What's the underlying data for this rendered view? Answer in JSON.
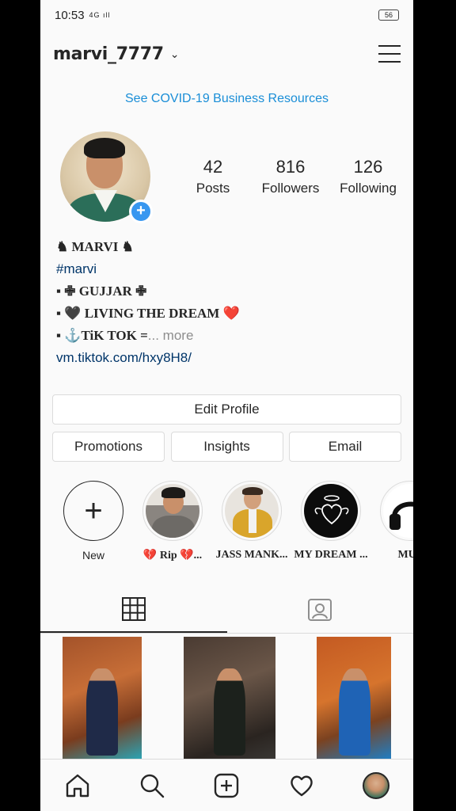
{
  "status": {
    "time": "10:53",
    "signal": "4G ıll",
    "battery": "56"
  },
  "header": {
    "username": "marvi_7777"
  },
  "banner": {
    "text": "See COVID-19 Business Resources"
  },
  "stats": [
    {
      "num": "42",
      "label": "Posts"
    },
    {
      "num": "816",
      "label": "Followers"
    },
    {
      "num": "126",
      "label": "Following"
    }
  ],
  "bio": {
    "name": "♞ MARVI ♞",
    "hashtag": "#marvi",
    "line1": "▪ ✙ GUJJAR ✙",
    "line2_prefix": "▪ 🖤 LIVING THE DREAM",
    "line2_heart": "❤️",
    "line3": "▪ ⚓TiK TOK =",
    "line3_more": "... more",
    "link": "vm.tiktok.com/hxy8H8/"
  },
  "buttons": {
    "edit": "Edit Profile",
    "promotions": "Promotions",
    "insights": "Insights",
    "email": "Email"
  },
  "highlights": [
    {
      "label": "New"
    },
    {
      "label": "💔 Rip 💔..."
    },
    {
      "label": "JASS MANK..."
    },
    {
      "label": "MY DREAM ..."
    },
    {
      "label": "MUS"
    }
  ],
  "colors": {
    "accent": "#3897f0",
    "link": "#003569",
    "banner": "#1a8ed7"
  }
}
